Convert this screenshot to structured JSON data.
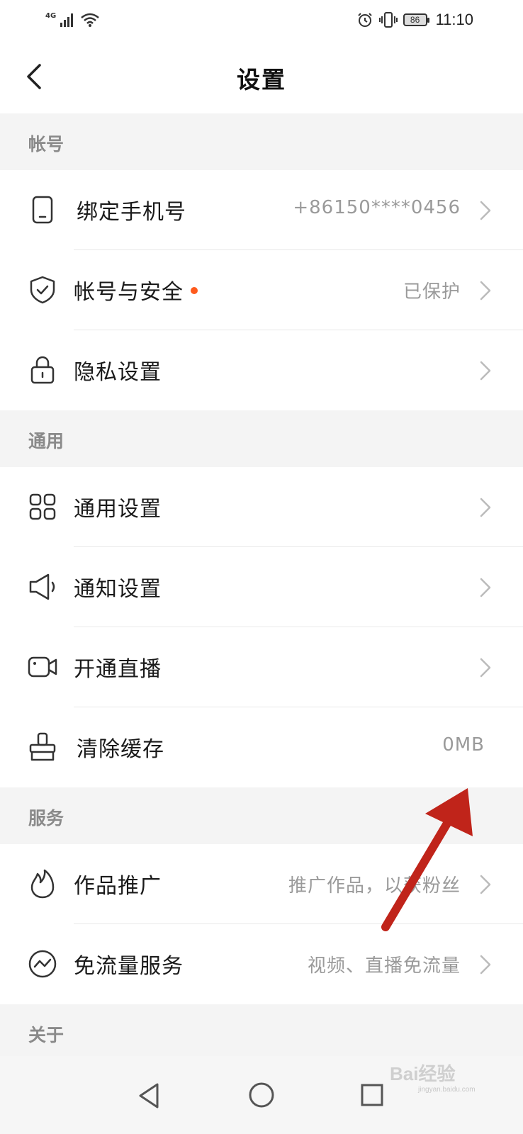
{
  "status_bar": {
    "network": "4G",
    "battery": "86",
    "time": "11:10"
  },
  "header": {
    "title": "设置"
  },
  "sections": [
    {
      "title": "帐号",
      "items": [
        {
          "label": "绑定手机号",
          "value": "+86150****0456",
          "icon": "phone-icon"
        },
        {
          "label": "帐号与安全",
          "value": "已保护",
          "icon": "shield-check-icon",
          "badge": "red-dot"
        },
        {
          "label": "隐私设置",
          "value": "",
          "icon": "lock-icon"
        }
      ]
    },
    {
      "title": "通用",
      "items": [
        {
          "label": "通用设置",
          "value": "",
          "icon": "grid-icon"
        },
        {
          "label": "通知设置",
          "value": "",
          "icon": "speaker-icon"
        },
        {
          "label": "开通直播",
          "value": "",
          "icon": "video-camera-icon"
        },
        {
          "label": "清除缓存",
          "value": "0MB",
          "icon": "broom-icon"
        }
      ]
    },
    {
      "title": "服务",
      "items": [
        {
          "label": "作品推广",
          "value": "推广作品，以获粉丝",
          "icon": "flame-icon"
        },
        {
          "label": "免流量服务",
          "value": "视频、直播免流量",
          "icon": "traffic-wave-icon"
        }
      ]
    },
    {
      "title": "关于",
      "items": []
    }
  ],
  "watermark": {
    "brand": "Bai经验",
    "url": "jingyan.baidu.com"
  },
  "colors": {
    "accent_dot": "#fe5a1d",
    "annotation_arrow": "#c0241a"
  }
}
